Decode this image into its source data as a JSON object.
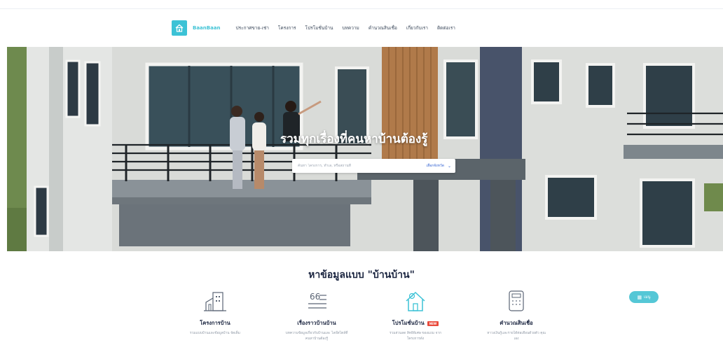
{
  "brand": {
    "name": "BaanBaan"
  },
  "nav": {
    "items": [
      "ประกาศขาย-เช่า",
      "โครงการ",
      "โปรโมชั่นบ้าน",
      "บทความ",
      "คำนวณสินเชื่อ",
      "เกี่ยวกับเรา",
      "ติดต่อเรา"
    ]
  },
  "hero": {
    "title": "รวมทุกเรื่องที่คนหาบ้านต้องรู้",
    "search_placeholder": "ค้นหา โครงการ, ทำเล, หรือสถานที่",
    "province_select": "เลือกจังหวัด"
  },
  "section": {
    "title": "หาข้อมูลแบบ \"บ้านบ้าน\"",
    "cards": [
      {
        "title": "โครงการบ้าน",
        "desc": "รวมแบบบ้านและข้อมูลบ้าน จัดเต็ม",
        "icon": "building-icon"
      },
      {
        "title": "เรื่องราวบ้านบ้าน",
        "desc": "บทความข้อมูลเกี่ยวกับบ้านและ ไลฟ์สไตล์ที่คนหาบ้านต้องรู้",
        "icon": "quote-icon"
      },
      {
        "title": "โปรโมชั่นบ้าน",
        "badge": "NEW",
        "desc": "รวมส่วนลด สิทธิพิเศษ ของแถม จากโครงการดัง",
        "icon": "house-gear-icon"
      },
      {
        "title": "คำนวณสินเชื่อ",
        "desc": "หาวงเงินกู้และรายได้ต่อเดือนด้วยตัว คุณเอง",
        "icon": "calculator-icon"
      }
    ]
  },
  "menu_button": {
    "label": "เมนู"
  },
  "colors": {
    "accent": "#3cc2d6",
    "link": "#2e5fd1",
    "badge": "#e94b3c",
    "heading": "#1b2540"
  }
}
